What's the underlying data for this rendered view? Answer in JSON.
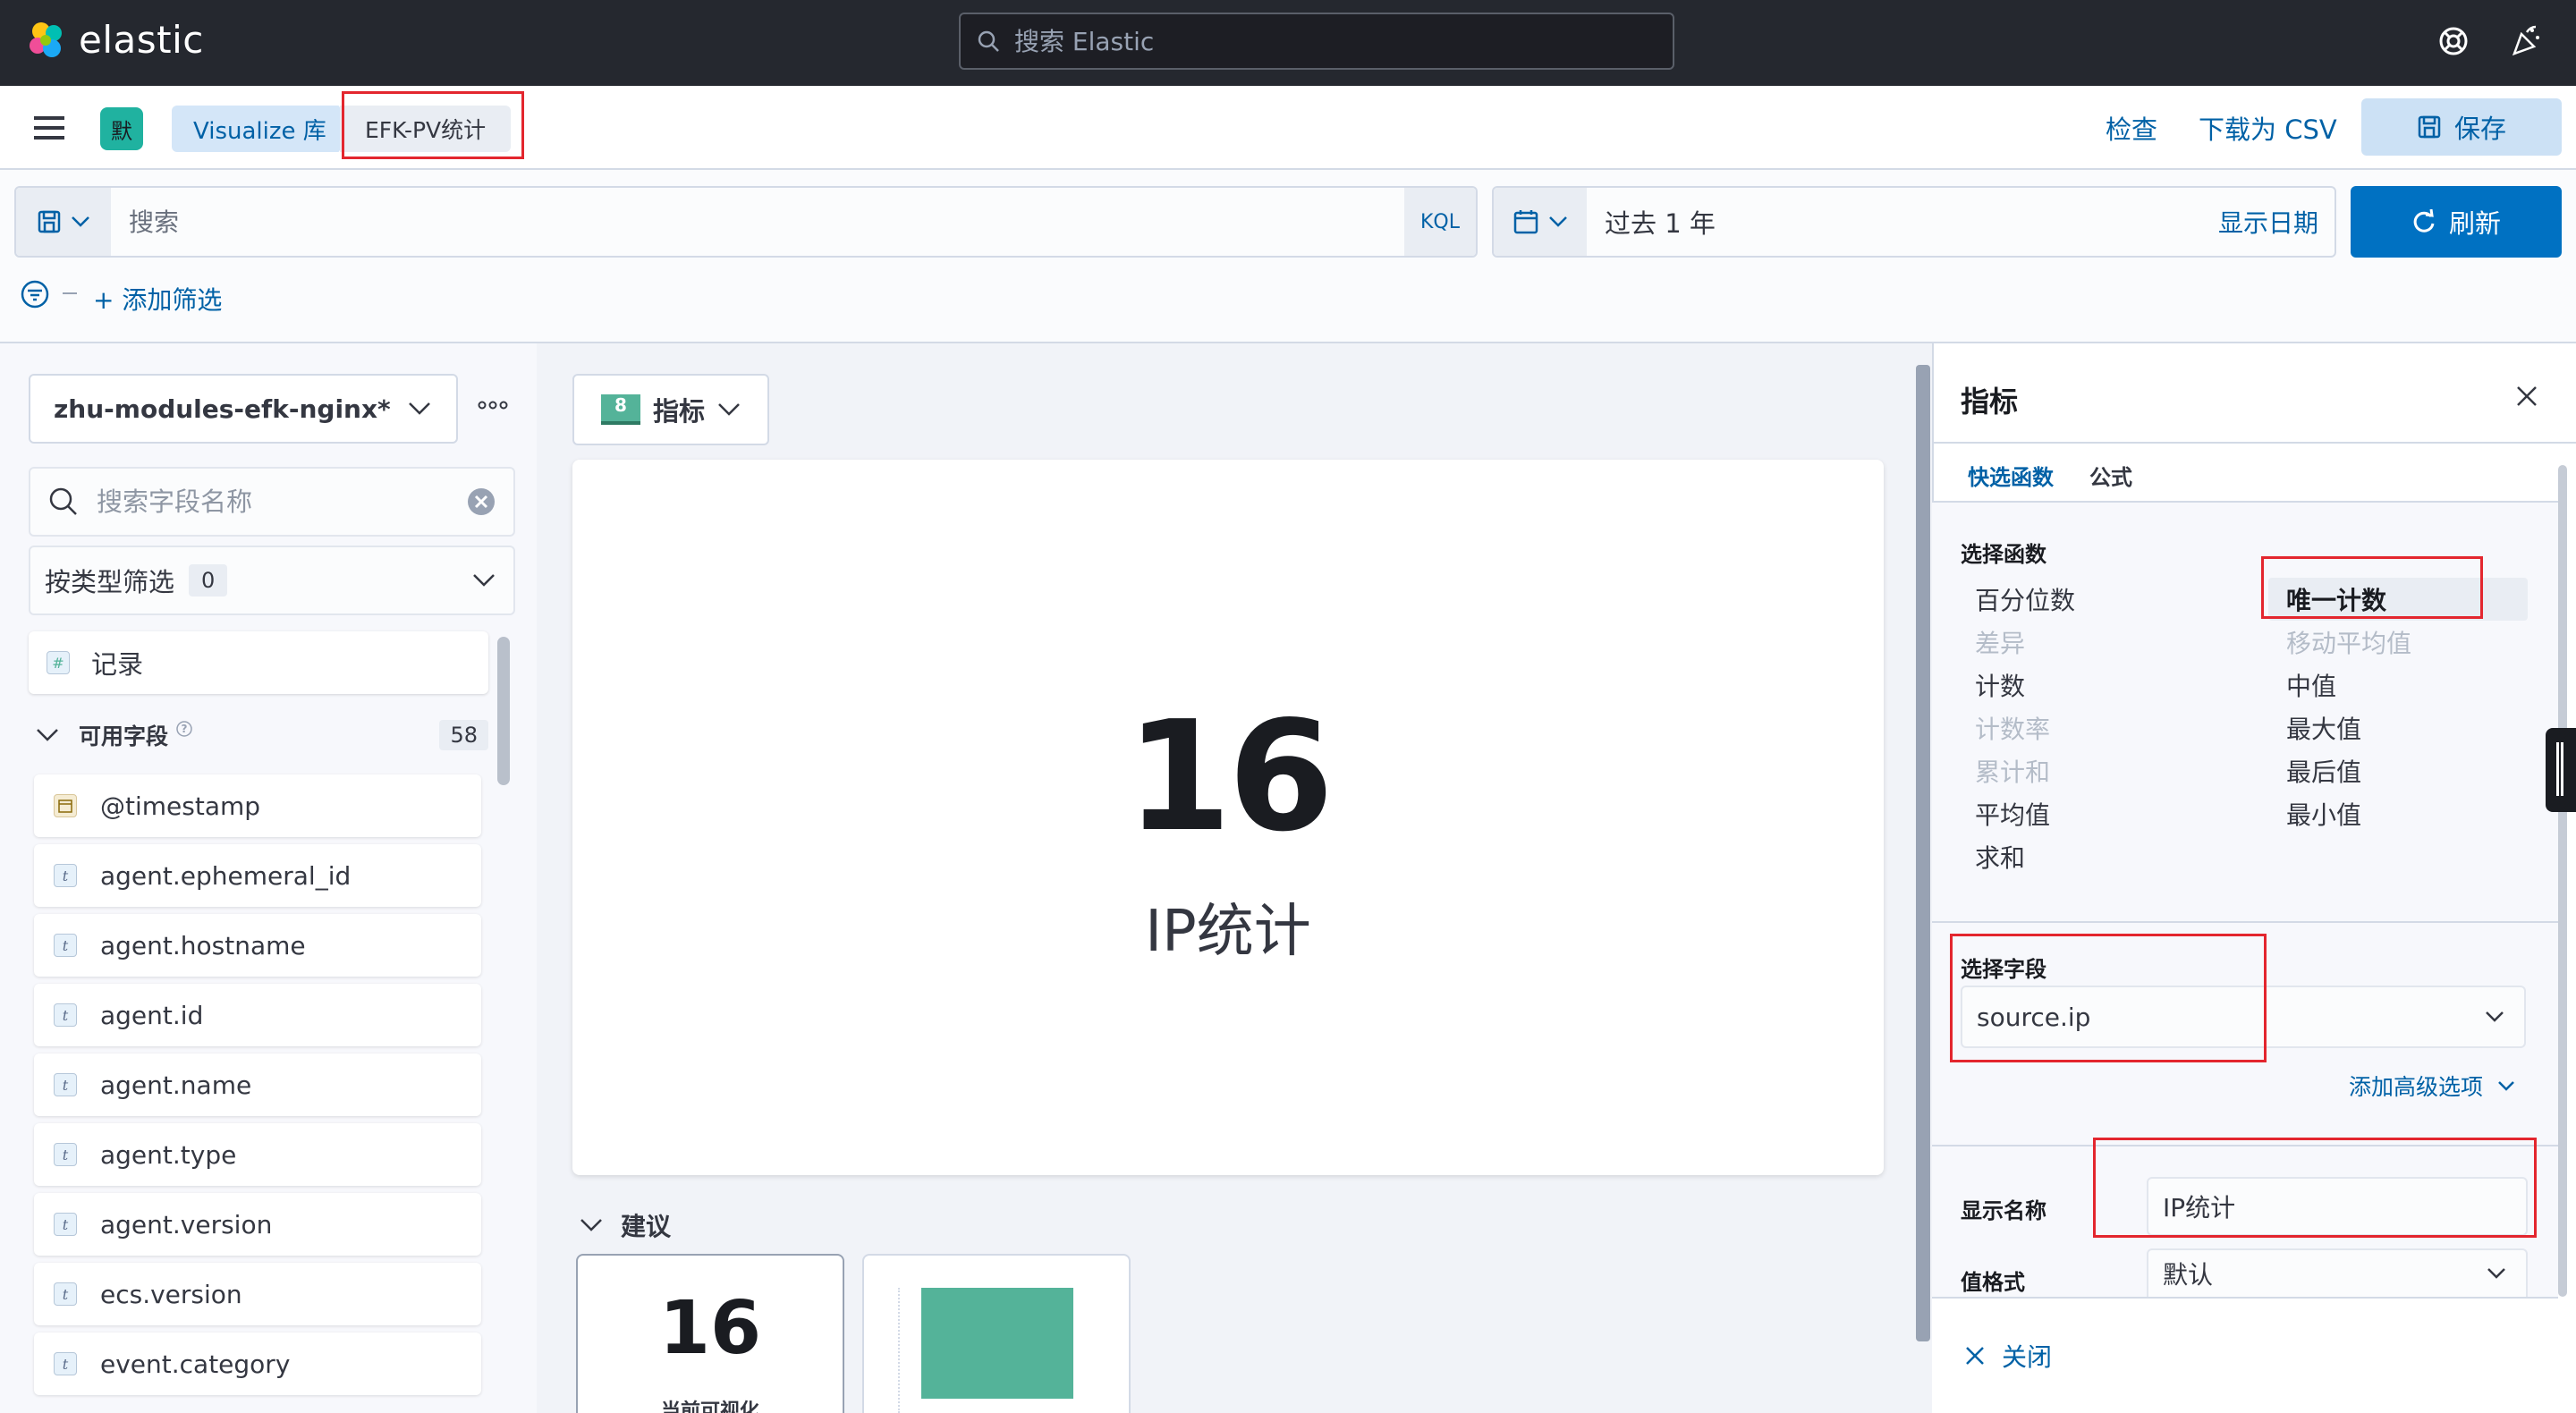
{
  "app": {
    "brand": "elastic",
    "search_placeholder": "搜索 Elastic"
  },
  "header": {
    "space_initial": "默",
    "breadcrumbs": [
      "Visualize 库",
      "EFK-PV统计"
    ],
    "inspect": "检查",
    "download_csv": "下载为 CSV",
    "save": "保存"
  },
  "query": {
    "search_placeholder": "搜索",
    "language": "KQL",
    "date_range": "过去 1 年",
    "show_dates": "显示日期",
    "refresh": "刷新",
    "add_filter": "+ 添加筛选"
  },
  "left_panel": {
    "index_pattern": "zhu-modules-efk-nginx*",
    "field_search_placeholder": "搜索字段名称",
    "type_filter_label": "按类型筛选",
    "type_filter_count": "0",
    "records_label": "记录",
    "records_type": "#",
    "available_fields_label": "可用字段",
    "available_fields_count": "58",
    "fields": [
      {
        "name": "@timestamp",
        "type": "date"
      },
      {
        "name": "agent.ephemeral_id",
        "type": "t"
      },
      {
        "name": "agent.hostname",
        "type": "t"
      },
      {
        "name": "agent.id",
        "type": "t"
      },
      {
        "name": "agent.name",
        "type": "t"
      },
      {
        "name": "agent.type",
        "type": "t"
      },
      {
        "name": "agent.version",
        "type": "t"
      },
      {
        "name": "ecs.version",
        "type": "t"
      },
      {
        "name": "event.category",
        "type": "t"
      }
    ]
  },
  "workspace": {
    "chart_type_badge": "8",
    "chart_type_label": "指标",
    "metric_value": "16",
    "metric_label": "IP统计",
    "suggestions_label": "建议",
    "suggestion_1_value": "16",
    "suggestion_1_label": "当前可视化"
  },
  "flyout": {
    "title": "指标",
    "tabs": [
      "快选函数",
      "公式"
    ],
    "select_function_label": "选择函数",
    "functions_left": [
      {
        "label": "百分位数",
        "enabled": true
      },
      {
        "label": "差异",
        "enabled": false
      },
      {
        "label": "计数",
        "enabled": true
      },
      {
        "label": "计数率",
        "enabled": false
      },
      {
        "label": "累计和",
        "enabled": false
      },
      {
        "label": "平均值",
        "enabled": true
      },
      {
        "label": "求和",
        "enabled": true
      }
    ],
    "functions_right": [
      {
        "label": "唯一计数",
        "enabled": true,
        "selected": true
      },
      {
        "label": "移动平均值",
        "enabled": false
      },
      {
        "label": "中值",
        "enabled": true
      },
      {
        "label": "最大值",
        "enabled": true
      },
      {
        "label": "最后值",
        "enabled": true
      },
      {
        "label": "最小值",
        "enabled": true
      }
    ],
    "select_field_label": "选择字段",
    "field_value": "source.ip",
    "advanced_options": "添加高级选项",
    "display_name_label": "显示名称",
    "display_name_value": "IP统计",
    "value_format_label": "值格式",
    "value_format_value": "默认",
    "close_label": "关闭"
  },
  "colors": {
    "topbar": "#25282f",
    "link_blue": "#0061a6",
    "primary": "#0071c2",
    "metric_green": "#54b399",
    "highlight_red": "#e3262e"
  }
}
